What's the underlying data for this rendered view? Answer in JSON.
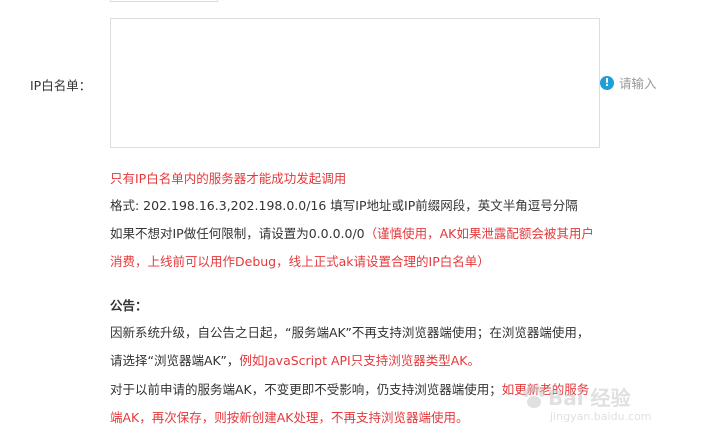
{
  "form": {
    "ip_label": "IP白名单：",
    "ip_value": "",
    "hint_text": "请输入"
  },
  "notes": {
    "warning": "只有IP白名单内的服务器才能成功发起调用",
    "format": "格式: 202.198.16.3,202.198.0.0/16 填写IP地址或IP前缀网段，英文半角逗号分隔",
    "no_limit_prefix": "如果不想对IP做任何限制，请设置为0.0.0.0/0",
    "no_limit_caution_1": "（谨慎使用，AK如果泄露配额会被其用户",
    "no_limit_caution_2": "消费，上线前可以用作Debug，线上正式ak请设置合理的IP白名单）"
  },
  "announcement": {
    "title": "公告：",
    "line1": "因新系统升级，自公告之日起，“服务端AK”不再支持浏览器端使用；在浏览器端使用，",
    "line2_prefix": "请选择“浏览器端AK”，",
    "line2_red": "例如JavaScript API只支持浏览器类型AK。",
    "line3_prefix": "对于以前申请的服务端AK，不变更即不受影响，仍支持浏览器端使用；",
    "line3_red": "如更新老的服务",
    "line4_red": "端AK，再次保存，则按新创建AK处理，不再支持浏览器端使用。"
  },
  "watermark": {
    "text": "Bai 经验",
    "url": "jingyan.baidu.com"
  },
  "colors": {
    "red": "#e4393c",
    "info_icon": "#1e9fd6",
    "hint": "#999999",
    "border": "#dedede"
  },
  "icons": {
    "hint": "info-icon",
    "watermark": "baidu-paw-icon"
  }
}
